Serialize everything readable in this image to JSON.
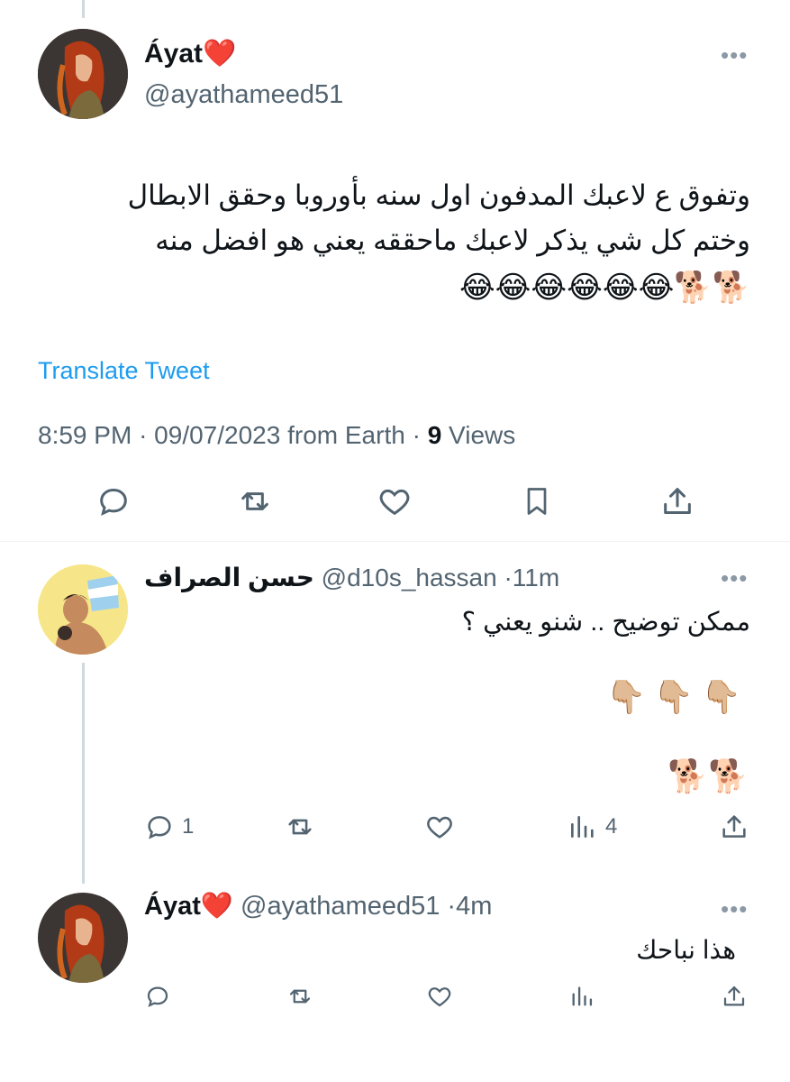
{
  "main_tweet": {
    "author_name": "Áyat",
    "author_handle": "@ayathameed51",
    "text_line1": "وتفوق ع لاعبك المدفون اول سنه بأوروبا وحقق الابطال",
    "text_line2": "وختم كل شي يذكر لاعبك ماحققه يعني هو افضل منه",
    "emoji_line": "🐕🐕😂😂😂😂😂😂",
    "translate_label": "Translate Tweet",
    "time": "8:59 PM",
    "date": "09/07/2023",
    "source": "from Earth",
    "views_count": "9",
    "views_label": "Views"
  },
  "reply1": {
    "author_name": "حسن الصراف",
    "author_handle": "@d10s_hassan",
    "time": "11m",
    "text": "ممكن توضيح .. شنو يعني ؟",
    "emoji_line1": "👇🏼👇🏼👇🏼",
    "emoji_line2": "🐕🐕",
    "reply_count": "1",
    "views_count": "4"
  },
  "reply2": {
    "author_name": "Áyat",
    "author_handle": "@ayathameed51",
    "time": "4m",
    "text": "هذا نباحك"
  },
  "separator": "·",
  "heart_color": "#e0245e",
  "link_color": "#1d9bf0",
  "icons": [
    "reply-icon",
    "retweet-icon",
    "like-icon",
    "bookmark-icon",
    "share-icon",
    "views-icon",
    "more-icon"
  ]
}
